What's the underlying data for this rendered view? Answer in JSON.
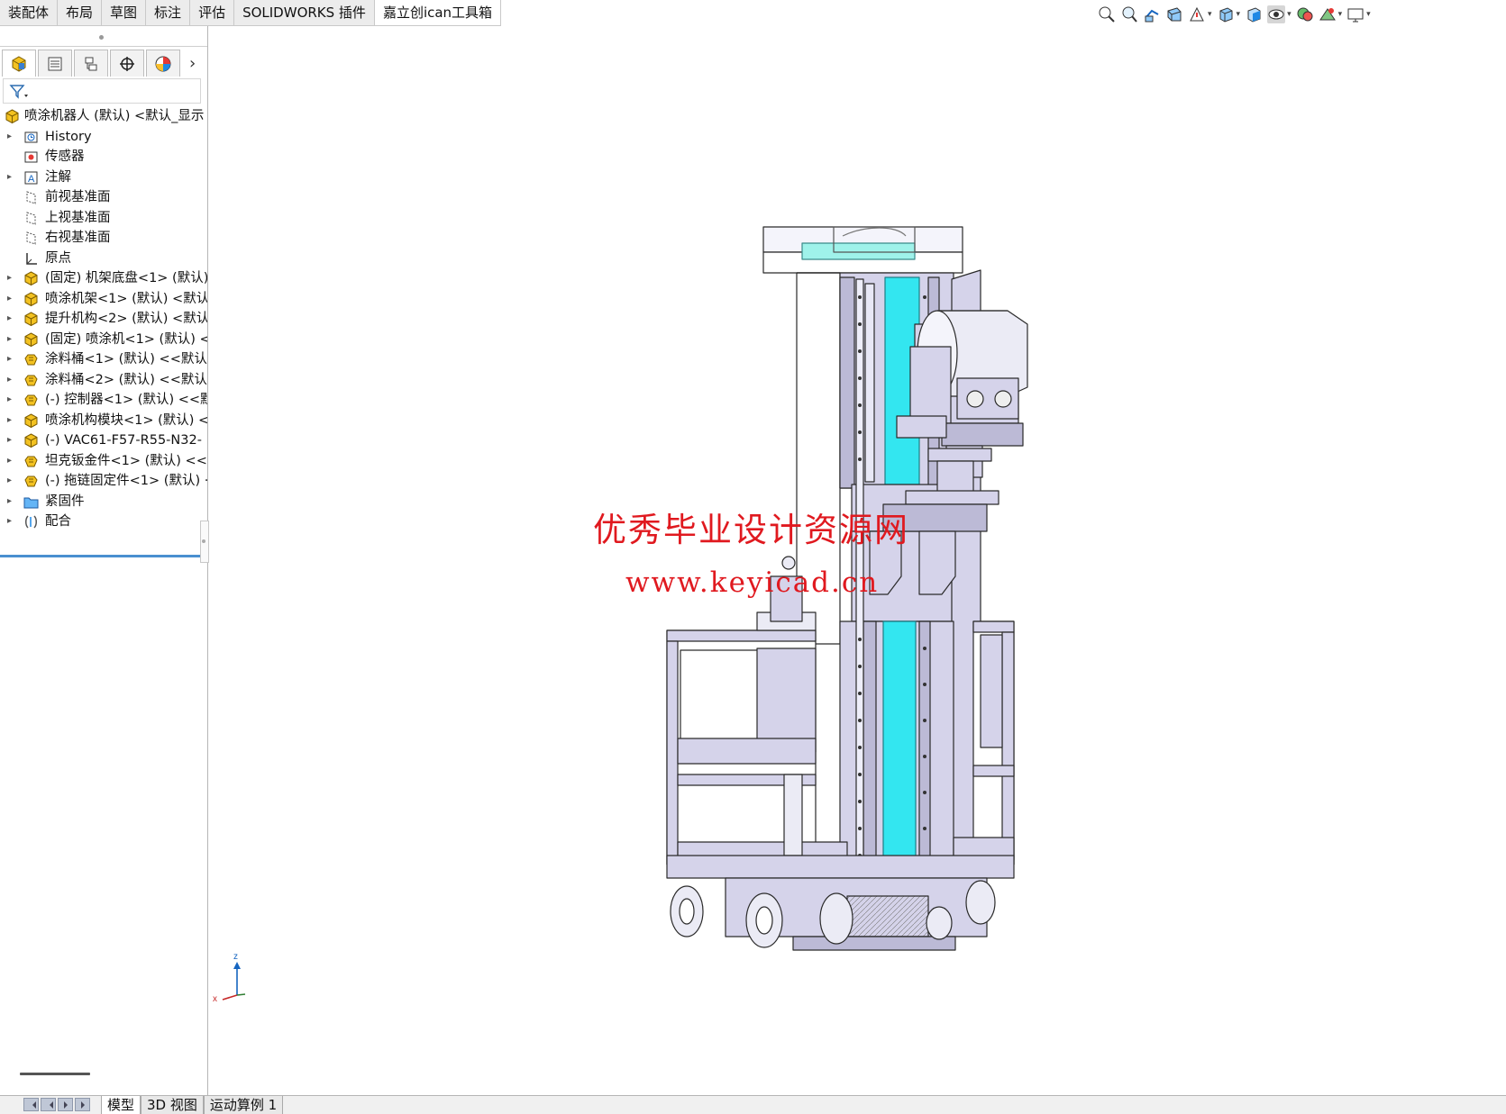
{
  "command_tabs": [
    {
      "label": "装配体"
    },
    {
      "label": "布局"
    },
    {
      "label": "草图"
    },
    {
      "label": "标注"
    },
    {
      "label": "评估"
    },
    {
      "label": "SOLIDWORKS 插件"
    },
    {
      "label": "嘉立创ican工具箱",
      "active": true
    }
  ],
  "view_toolbar": {
    "icons": [
      "zoom-to-fit-icon",
      "zoom-area-icon",
      "previous-view-icon",
      "section-view-icon",
      "dynamic-annotation-icon",
      "view-orientation-icon",
      "display-style-icon",
      "hide-show-items-icon",
      "edit-appearance-icon",
      "apply-scene-icon",
      "view-settings-icon"
    ]
  },
  "feature_tree": {
    "root": "喷涂机器人 (默认) <默认_显示",
    "nodes": [
      {
        "label": "History",
        "icon": "history-icon",
        "expandable": true
      },
      {
        "label": "传感器",
        "icon": "sensor-icon",
        "expandable": false
      },
      {
        "label": "注解",
        "icon": "annotation-icon",
        "expandable": true
      },
      {
        "label": "前视基准面",
        "icon": "plane-icon",
        "expandable": false
      },
      {
        "label": "上视基准面",
        "icon": "plane-icon",
        "expandable": false
      },
      {
        "label": "右视基准面",
        "icon": "plane-icon",
        "expandable": false
      },
      {
        "label": "原点",
        "icon": "origin-icon",
        "expandable": false
      },
      {
        "label": "(固定) 机架底盘<1> (默认)",
        "icon": "assembly-icon",
        "expandable": true
      },
      {
        "label": "喷涂机架<1> (默认) <默认",
        "icon": "assembly-icon",
        "expandable": true
      },
      {
        "label": "提升机构<2> (默认) <默认",
        "icon": "assembly-icon",
        "expandable": true
      },
      {
        "label": "(固定) 喷涂机<1> (默认) <",
        "icon": "assembly-icon",
        "expandable": true
      },
      {
        "label": "涂料桶<1> (默认) <<默认",
        "icon": "part-icon",
        "expandable": true
      },
      {
        "label": "涂料桶<2> (默认) <<默认",
        "icon": "part-icon",
        "expandable": true
      },
      {
        "label": "(-) 控制器<1> (默认) <<默",
        "icon": "part-icon",
        "expandable": true
      },
      {
        "label": "喷涂机构模块<1> (默认) <",
        "icon": "assembly-icon",
        "expandable": true
      },
      {
        "label": "(-) VAC61-F57-R55-N32-",
        "icon": "assembly-icon",
        "expandable": true
      },
      {
        "label": "坦克钣金件<1> (默认) <<",
        "icon": "part-icon",
        "expandable": true
      },
      {
        "label": "(-) 拖链固定件<1> (默认) ·",
        "icon": "part-icon",
        "expandable": true
      },
      {
        "label": "紧固件",
        "icon": "folder-icon",
        "expandable": true
      },
      {
        "label": "配合",
        "icon": "mates-icon",
        "expandable": true
      }
    ]
  },
  "bottom_tabs": [
    {
      "label": "模型",
      "active": true
    },
    {
      "label": "3D 视图"
    },
    {
      "label": "运动算例 1"
    }
  ],
  "triad": {
    "z_label": "z",
    "x_label": "x"
  },
  "watermark": {
    "cn": "优秀毕业设计资源网",
    "url": "www.keyicad.cn"
  },
  "colors": {
    "part_fill": "#d5d3ea",
    "part_edge": "#2a2a2a",
    "rail_cyan": "#33e6f0",
    "watermark_red": "#e0191f",
    "assembly_yellow": "#f3c221"
  }
}
